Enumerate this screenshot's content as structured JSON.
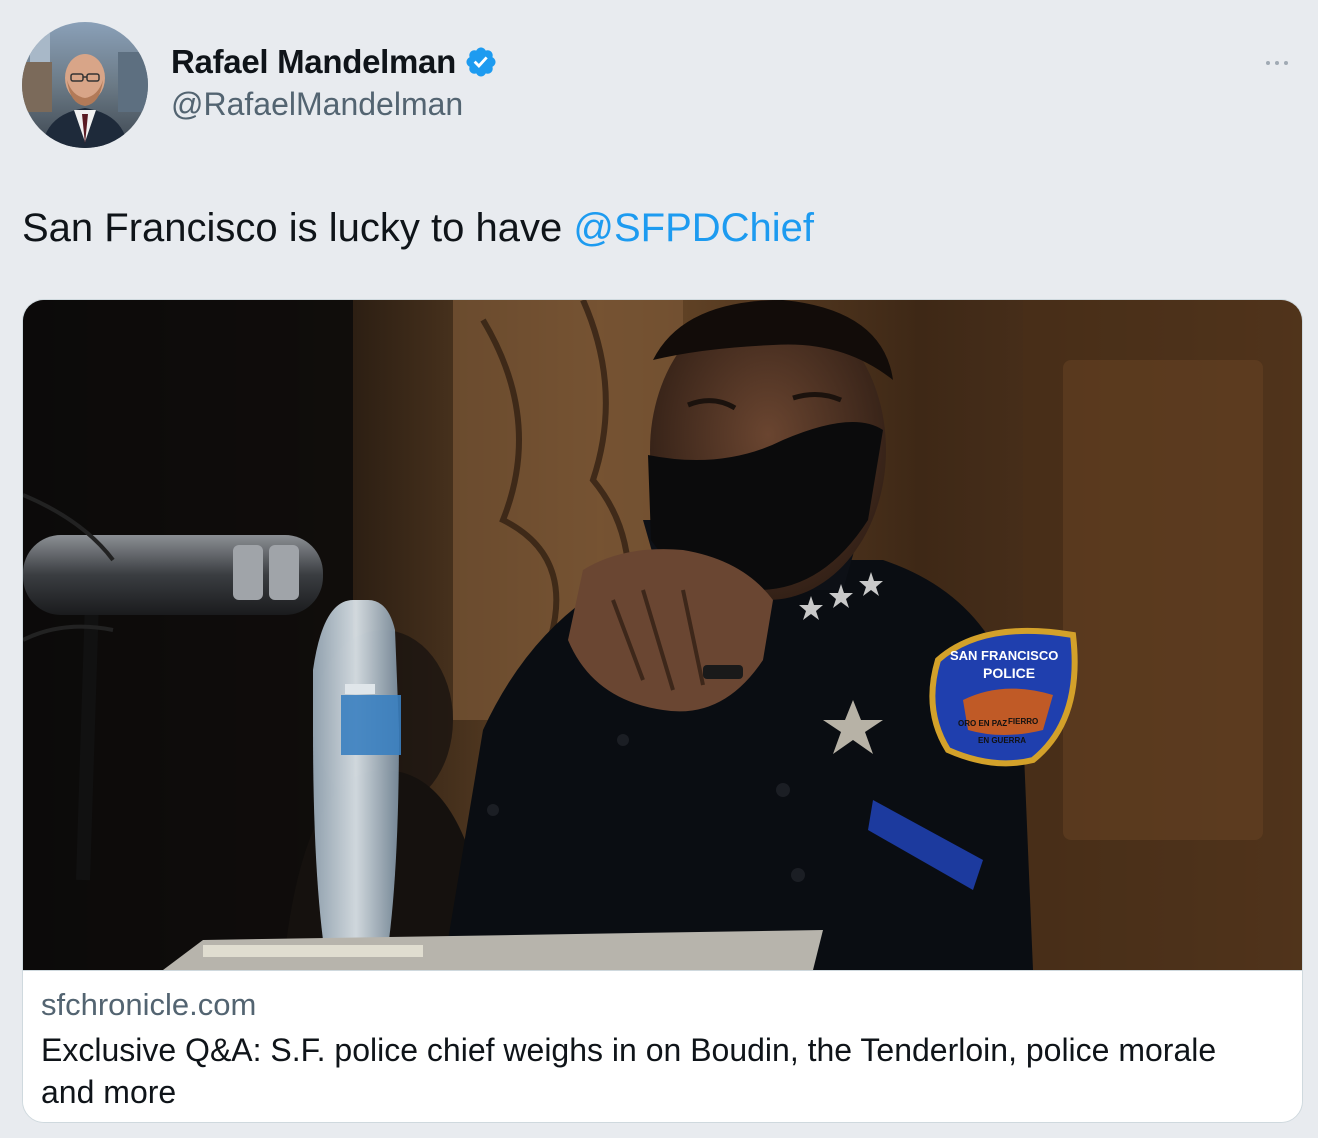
{
  "author": {
    "display_name": "Rafael Mandelman",
    "handle": "@RafaelMandelman",
    "verified": true,
    "avatar_icon": "profile-photo"
  },
  "tweet": {
    "text": "San Francisco is lucky to have ",
    "mention": "@SFPDChief"
  },
  "card": {
    "domain": "sfchronicle.com",
    "title": "Exclusive Q&A: S.F. police chief weighs in on Boudin, the Tenderloin, police morale and more",
    "image": "photo of police chief seated at microphone, wearing black face mask",
    "patch_text": [
      "SAN FRANCISCO",
      "POLICE",
      "ORO EN PAZ",
      "FIERRO",
      "EN GUERRA"
    ]
  },
  "icons": {
    "more": "more-horizontal-icon",
    "verified": "verified-badge-icon"
  },
  "colors": {
    "link": "#1d9bf0",
    "verified": "#1d9bf0",
    "secondary_text": "#536471",
    "background": "#e8ebef"
  }
}
